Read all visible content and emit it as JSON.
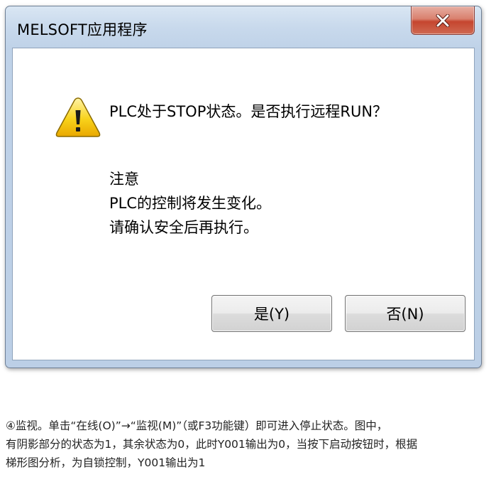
{
  "window": {
    "title": "MELSOFT应用程序",
    "close_icon": "close-icon"
  },
  "dialog": {
    "icon": "warning-icon",
    "message": "PLC处于STOP状态。是否执行远程RUN？",
    "note_title": "注意",
    "note_line1": "PLC的控制将发生变化。",
    "note_line2": "请确认安全后再执行。",
    "yes_label": "是(Y)",
    "no_label": "否(N)"
  },
  "caption": {
    "line1": "④监视。单击“在线(O)”→“监视(M)”（或F3功能键）即可进入停止状态。图中，",
    "line2": "有阴影部分的状态为1，其余状态为0，此时Y001输出为0，当按下启动按钮时，根据",
    "line3": "梯形图分析，为自锁控制，Y001输出为1"
  },
  "colors": {
    "title_gradient_top": "#d9e6f3",
    "close_button": "#c5452f",
    "warning_yellow": "#f5c400"
  }
}
